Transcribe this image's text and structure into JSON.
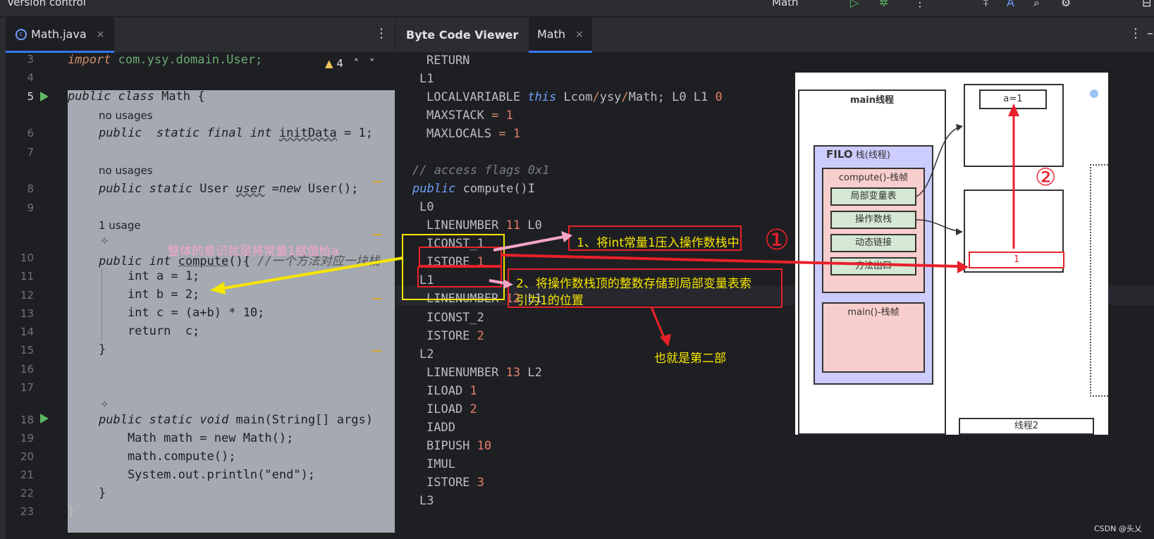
{
  "topbar": {
    "vc_label": "Version control ˅",
    "run_config": "Math ˅"
  },
  "left_tabs": {
    "file_tab": "Math.java",
    "close": "×"
  },
  "right_tabs": {
    "panel_title": "Byte Code Viewer",
    "class_tab": "Math",
    "close": "×"
  },
  "editor": {
    "warning_count": "4",
    "line_numbers": [
      "3",
      "4",
      "5",
      "6",
      "7",
      "8",
      "9",
      "10",
      "11",
      "12",
      "13",
      "14",
      "15",
      "16",
      "17",
      "18",
      "19",
      "20",
      "21",
      "22",
      "23"
    ],
    "lines": {
      "l3_kw": "import",
      "l3_rest": " com.ysy.domain.User;",
      "l5_a": "public class ",
      "l5_b": "Math {",
      "hint1": "no usages",
      "l6_a": "public  static final int ",
      "l6_b": "initData",
      "l6_c": " = 1;",
      "hint2": "no usages",
      "l8_a": "public static ",
      "l8_b": "User ",
      "l8_c": "user",
      "l8_d": " =",
      "l8_e": "new",
      "l8_f": " User();",
      "hint3": "1 usage",
      "l10_a": "public int ",
      "l10_b": "compute",
      "l10_c": "(){ ",
      "l10_d": "//一个方法对应一块栈",
      "l11": "    int a = 1;",
      "l12": "    int b = 2;",
      "l13": "    int c = (a+b) * 10;",
      "l14": "    return  c;",
      "l15": "}",
      "l18_a": "public static void ",
      "l18_b": "main(String[] args)",
      "l19": "    Math math = new Math();",
      "l20": "    math.compute();",
      "l21": "    System.out.println(\"end\");",
      "l22": "}",
      "l23": "}"
    }
  },
  "bytecode": {
    "lines": [
      "RETURN",
      "L1",
      "LOCALVARIABLE",
      "MAXSTACK",
      "MAXLOCALS",
      "// access flags 0x1",
      "public",
      "compute()I",
      "L0",
      "LINENUMBER",
      "ICONST_1",
      "ISTORE",
      "L1",
      "LINENUMBER",
      "ICONST_2",
      "ISTORE",
      "L2",
      "LINENUMBER",
      "ILOAD",
      "ILOAD",
      "IADD",
      "BIPUSH",
      "IMUL",
      "ISTORE",
      "L3"
    ],
    "localvar_this": "this",
    "localvar_rest_a": " Lcom",
    "localvar_rest_b": "ysy",
    "localvar_rest_c": "Math; L0 L1 ",
    "localvar_idx": "0",
    "eq": "=",
    "one": "1",
    "ln11": "11",
    "ln11_label": " L0",
    "ln12": "12",
    "ln12_label": " L1",
    "ln13": "13",
    "ln13_label": " L2",
    "istore1": "1",
    "istore2": "2",
    "iload1": "1",
    "iload2": "2",
    "bipush": "10",
    "istore3": "3"
  },
  "annotations": {
    "pink_left": "整体的意识就是将常量1赋值给a",
    "note1": "1、将int常量1压入操作数栈中",
    "note2_line1": "2、将操作数栈顶的整数存储到局部变量表索",
    "note2_line2": "引为1的位置",
    "note3": "也就是第二部",
    "circle1": "①",
    "circle2": "②"
  },
  "diagram": {
    "main_thread": "main线程",
    "filo": "FILO",
    "stack_label": "栈(线程)",
    "compute_frame": "compute()-栈帧",
    "local_vars": "局部变量表",
    "operand_stack": "操作数栈",
    "dynamic_link": "动态链接",
    "method_exit": "方法出口",
    "main_frame": "main()-栈帧",
    "heap_a": "a=1",
    "slot_1": "1",
    "thread2": "线程2"
  },
  "watermark": "CSDN @头乂",
  "colors": {
    "accent": "#3574f0",
    "annotation_red": "#e8212b",
    "annotation_yellow": "#f6e600",
    "annotation_pink": "#f4a6c6"
  }
}
